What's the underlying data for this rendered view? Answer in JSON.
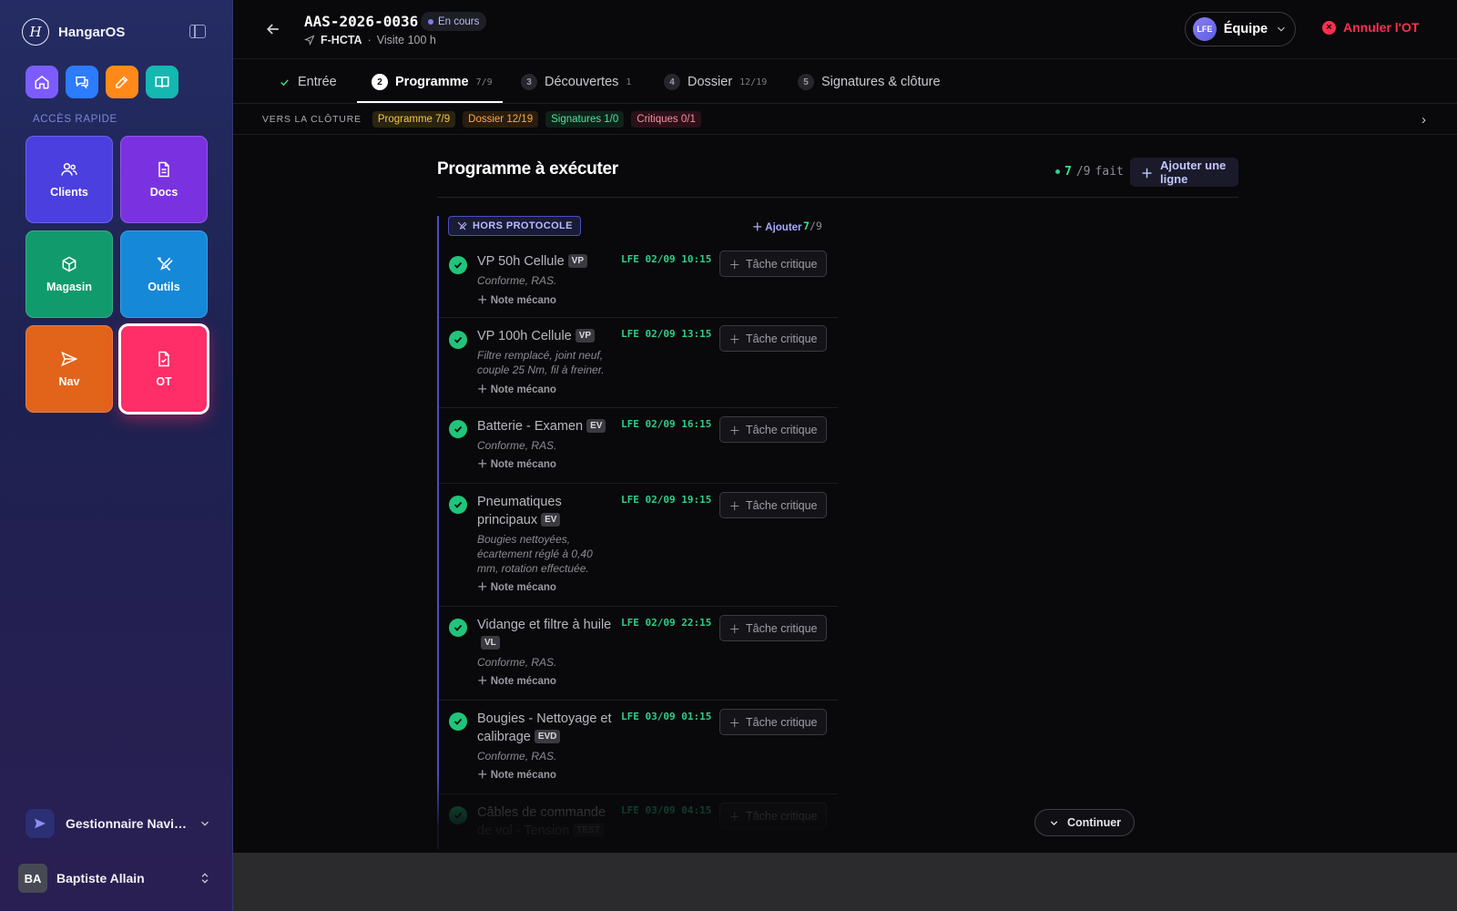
{
  "app": {
    "name": "HangarOS"
  },
  "sidebar": {
    "quick_access_label": "ACCÈS RAPIDE",
    "quick_buttons": [
      {
        "icon": "home-icon",
        "color": "#7c5cff"
      },
      {
        "icon": "chat-icon",
        "color": "#2b7cff"
      },
      {
        "icon": "edit-icon",
        "color": "#ff8a1a"
      },
      {
        "icon": "book-icon",
        "color": "#14b8b0"
      }
    ],
    "tiles": [
      {
        "label": "Clients",
        "icon": "users-icon",
        "color": "#4c3fe0"
      },
      {
        "label": "Docs",
        "icon": "document-icon",
        "color": "#7a32e0"
      },
      {
        "label": "Magasin",
        "icon": "box-icon",
        "color": "#119a6b"
      },
      {
        "label": "Outils",
        "icon": "tools-icon",
        "color": "#1688d8"
      },
      {
        "label": "Nav",
        "icon": "send-icon",
        "color": "#e2641a"
      },
      {
        "label": "OT",
        "icon": "work-order-icon",
        "color": "#ff2d68"
      }
    ],
    "role": "Gestionnaire Navigabilité",
    "user": {
      "initials": "BA",
      "name": "Baptiste Allain"
    }
  },
  "header": {
    "ot_id": "AAS-2026-0036",
    "status": "En cours",
    "registration": "F-HCTA",
    "visit": "Visite 100 h",
    "team_initials": "LFE",
    "team_label": "Équipe",
    "cancel_label": "Annuler l'OT"
  },
  "tabs": [
    {
      "num": "",
      "label": "Entrée",
      "count": ""
    },
    {
      "num": "2",
      "label": "Programme",
      "count": "7/9"
    },
    {
      "num": "3",
      "label": "Découvertes",
      "count": "1"
    },
    {
      "num": "4",
      "label": "Dossier",
      "count": "12/19"
    },
    {
      "num": "5",
      "label": "Signatures & clôture",
      "count": ""
    }
  ],
  "closure": {
    "title": "VERS LA CLÔTURE",
    "chips": [
      {
        "label": "Programme 7/9",
        "color": "#f5c542",
        "bg": "#2a2410"
      },
      {
        "label": "Dossier 12/19",
        "color": "#ffa940",
        "bg": "#2a1d0e"
      },
      {
        "label": "Signatures 1/0",
        "color": "#4be3a1",
        "bg": "#0e2219"
      },
      {
        "label": "Critiques 0/1",
        "color": "#ff8aa3",
        "bg": "#2a1118"
      }
    ]
  },
  "program": {
    "title": "Programme à exécuter",
    "done": "7",
    "total": "/9",
    "done_suffix": "fait",
    "add_line_label": "Ajouter une ligne",
    "group": {
      "label": "HORS PROTOCOLE",
      "add_label": "Ajouter",
      "done": "7",
      "total": "/9"
    },
    "note_label": "Note mécano",
    "critical_label": "Tâche critique",
    "tasks": [
      {
        "name": "VP 50h Cellule",
        "code": "VP",
        "note": "Conforme, RAS.",
        "meta": "LFE 02/09 10:15"
      },
      {
        "name": "VP 100h Cellule",
        "code": "VP",
        "note": "Filtre remplacé, joint neuf, couple 25 Nm, fil à freiner.",
        "meta": "LFE 02/09 13:15"
      },
      {
        "name": "Batterie - Examen",
        "code": "EV",
        "note": "Conforme, RAS.",
        "meta": "LFE 02/09 16:15"
      },
      {
        "name": "Pneumatiques principaux",
        "code": "EV",
        "note": "Bougies nettoyées, écartement réglé à 0,40 mm, rotation effectuée.",
        "meta": "LFE 02/09 19:15"
      },
      {
        "name": "Vidange et filtre à huile",
        "code": "VL",
        "note": "Conforme, RAS.",
        "meta": "LFE 02/09 22:15"
      },
      {
        "name": "Bougies - Nettoyage et calibrage",
        "code": "EVD",
        "note": "Conforme, RAS.",
        "meta": "LFE 03/09 01:15"
      },
      {
        "name": "Câbles de commande de vol - Tension",
        "code": "TEST",
        "note": "",
        "meta": "LFE 03/09 04:15"
      }
    ]
  },
  "continue_label": "Continuer"
}
